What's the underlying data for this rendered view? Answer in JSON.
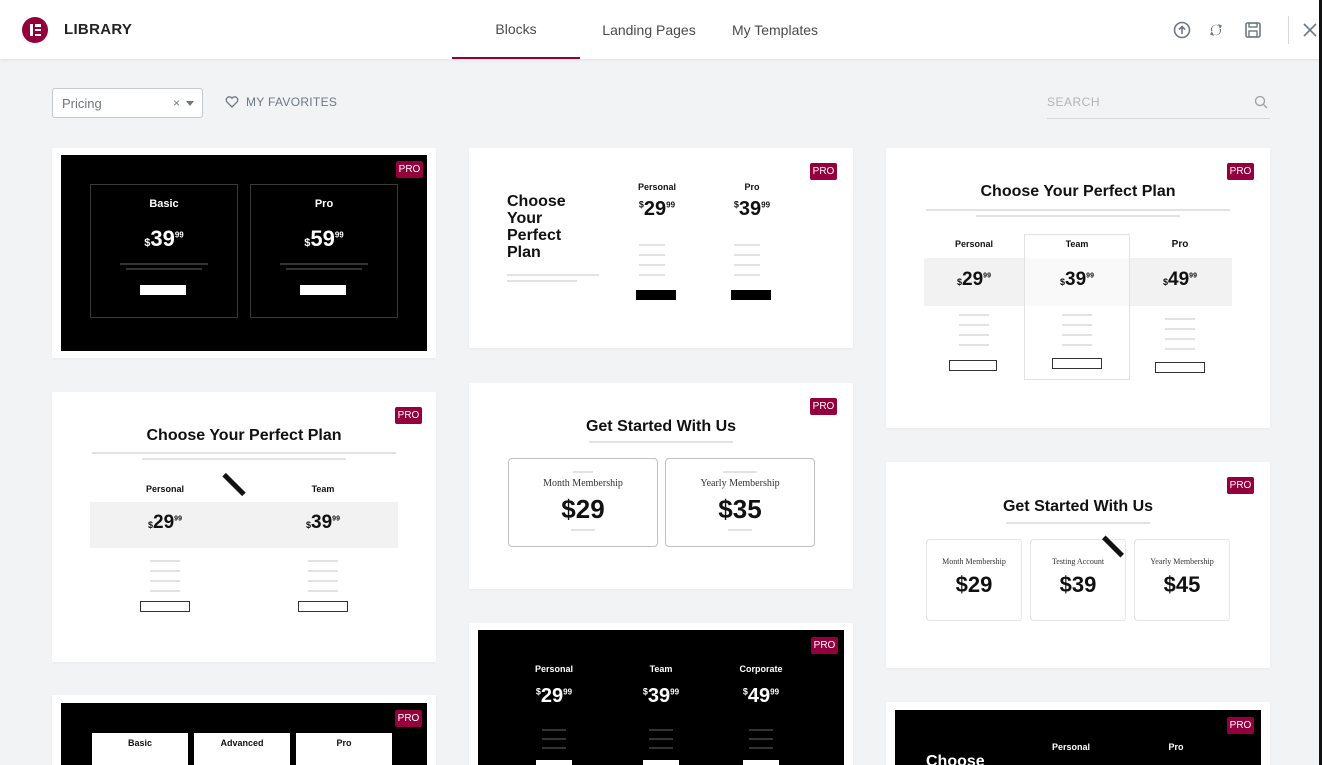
{
  "header": {
    "title": "LIBRARY",
    "tabs": [
      {
        "label": "Blocks",
        "active": true
      },
      {
        "label": "Landing Pages",
        "active": false
      },
      {
        "label": "My Templates",
        "active": false
      }
    ],
    "icons": [
      "upload-icon",
      "sync-icon",
      "save-icon",
      "close-icon"
    ],
    "accent_color": "#93003c"
  },
  "filters": {
    "category_value": "Pricing",
    "clear_symbol": "×",
    "favorites_label": "MY FAVORITES",
    "search_placeholder": "SEARCH"
  },
  "badge": "PRO",
  "cards": {
    "c1": {
      "plans": [
        "Basic",
        "Pro"
      ],
      "prices": [
        "39",
        "59"
      ]
    },
    "c2": {
      "title": "Choose Your Perfect Plan",
      "plans": [
        "Personal",
        "Pro"
      ],
      "prices": [
        "29",
        "39"
      ]
    },
    "c3": {
      "title": "Choose Your Perfect Plan",
      "plans": [
        "Personal",
        "Team",
        "Pro"
      ],
      "prices": [
        "29",
        "39",
        "49"
      ]
    },
    "c4": {
      "title": "Choose Your Perfect Plan",
      "plans": [
        "Personal",
        "Team"
      ],
      "prices": [
        "29",
        "39"
      ]
    },
    "c5": {
      "title": "Get Started With Us",
      "plans": [
        "Month Membership",
        "Yearly Membership"
      ],
      "prices": [
        "$29",
        "$35"
      ]
    },
    "c6": {
      "title": "Get Started With Us",
      "plans": [
        "Month Membership",
        "Testing Account",
        "Yearly Membership"
      ],
      "prices": [
        "$29",
        "$39",
        "$45"
      ]
    },
    "c7": {
      "plans": [
        "Basic",
        "Advanced",
        "Pro"
      ]
    },
    "c8": {
      "plans": [
        "Personal",
        "Team",
        "Corporate"
      ],
      "prices": [
        "29",
        "39",
        "49"
      ]
    },
    "c9": {
      "title": "Choose",
      "plans": [
        "Personal",
        "Pro"
      ]
    }
  }
}
